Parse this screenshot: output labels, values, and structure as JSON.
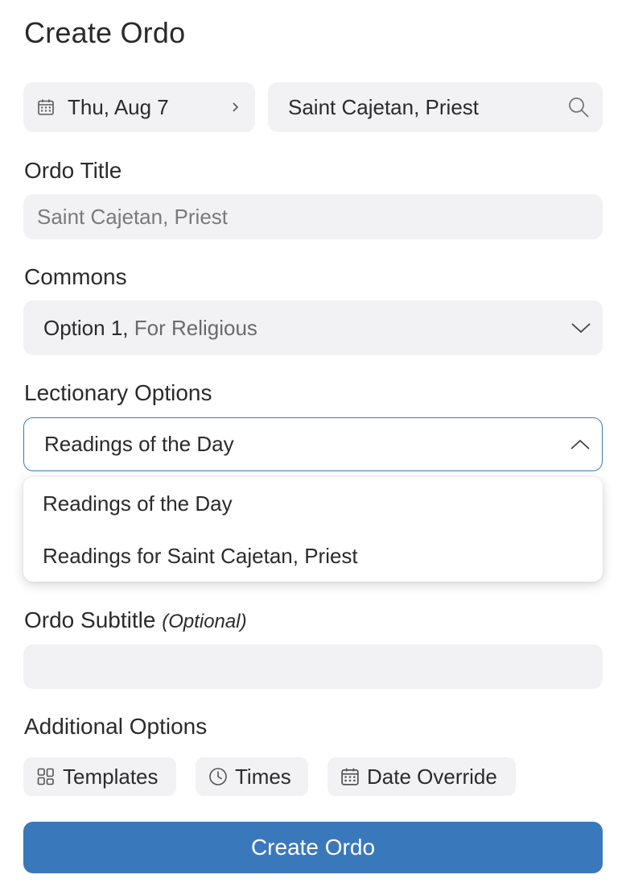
{
  "page": {
    "title": "Create Ordo"
  },
  "date_picker": {
    "value": "Thu, Aug 7"
  },
  "celebration_search": {
    "value": "Saint Cajetan, Priest"
  },
  "ordo_title": {
    "label": "Ordo Title",
    "placeholder": "Saint Cajetan, Priest"
  },
  "commons": {
    "label": "Commons",
    "selected_option": "Option 1,",
    "selected_detail": "For Religious"
  },
  "lectionary": {
    "label": "Lectionary Options",
    "selected": "Readings of the Day",
    "options": [
      "Readings of the Day",
      "Readings for Saint Cajetan, Priest"
    ]
  },
  "ordo_subtitle": {
    "label": "Ordo Subtitle",
    "optional_hint": "(Optional)",
    "value": ""
  },
  "additional_options": {
    "label": "Additional Options",
    "chips": [
      "Templates",
      "Times",
      "Date Override"
    ]
  },
  "submit": {
    "label": "Create Ordo"
  },
  "colors": {
    "accent": "#3a78bc",
    "field_bg": "#f2f2f4",
    "focus_border": "#3d7abf"
  }
}
